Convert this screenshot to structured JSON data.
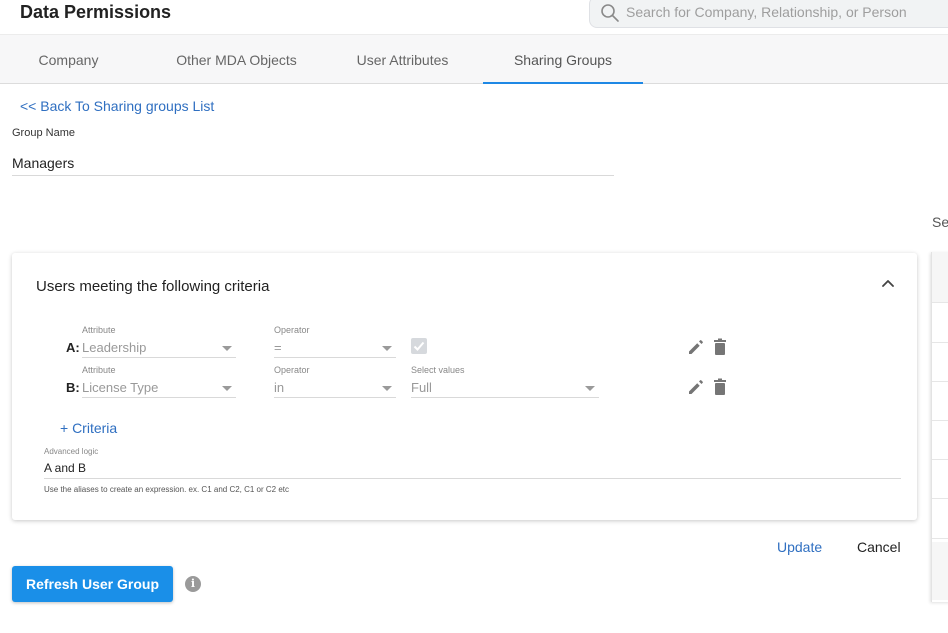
{
  "header": {
    "title": "Data Permissions",
    "search_placeholder": "Search for Company, Relationship, or Person"
  },
  "tabs": [
    {
      "label": "Company",
      "active": false
    },
    {
      "label": "Other MDA Objects",
      "active": false
    },
    {
      "label": "User Attributes",
      "active": false
    },
    {
      "label": "Sharing Groups",
      "active": true
    }
  ],
  "back_link": "<< Back To Sharing groups List",
  "group": {
    "label": "Group Name",
    "value": "Managers"
  },
  "side_text": "Se",
  "criteria_card": {
    "title": "Users meeting the following criteria",
    "rows": [
      {
        "alias": "A:",
        "attribute_label": "Attribute",
        "attribute_value": "Leadership",
        "operator_label": "Operator",
        "operator_value": "=",
        "value_checkbox": true
      },
      {
        "alias": "B:",
        "attribute_label": "Attribute",
        "attribute_value": "License Type",
        "operator_label": "Operator",
        "operator_value": "in",
        "values_label": "Select values",
        "values_value": "Full"
      }
    ],
    "add_criteria": "+ Criteria",
    "advanced_logic_label": "Advanced logic",
    "advanced_logic_value": "A and B",
    "advanced_logic_hint": "Use the aliases to create an expression. ex. C1 and C2, C1 or C2 etc"
  },
  "actions": {
    "update": "Update",
    "cancel": "Cancel",
    "refresh": "Refresh User Group",
    "info_icon": "i"
  },
  "colors": {
    "accent": "#1a8fe8",
    "link": "#2f6fc1",
    "active_tab_underline": "#1e88e5"
  }
}
